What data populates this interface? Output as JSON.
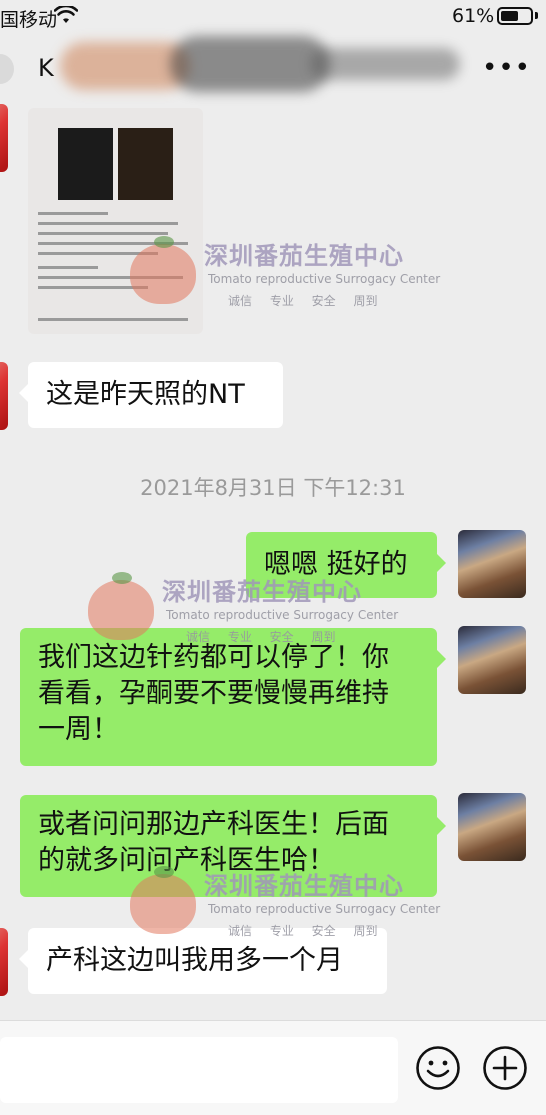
{
  "status_bar": {
    "carrier": "国移动",
    "battery_percent": "61%",
    "battery_level": 0.61
  },
  "nav": {
    "title": "K",
    "more_label": "•••"
  },
  "messages": [
    {
      "side": "in",
      "type": "text",
      "text": "这是昨天照的NT"
    },
    {
      "side": "out",
      "type": "text",
      "text": "嗯嗯 挺好的"
    },
    {
      "side": "out",
      "type": "text",
      "lines": [
        "我们这边针药都可以停了！你",
        "看看，孕酮要不要慢慢再维持",
        "一周！"
      ]
    },
    {
      "side": "out",
      "type": "text",
      "lines": [
        "或者问问那边产科医生！后面",
        "的就多问问产科医生哈！"
      ]
    },
    {
      "side": "in",
      "type": "text",
      "text": "产科这边叫我用多一个月"
    }
  ],
  "timestamp": "2021年8月31日 下午12:31",
  "watermark": {
    "title": "深圳番茄生殖中心",
    "subtitle": "Tomato reproductive Surrogacy Center",
    "tagline": "诚信 专业 安全 周到"
  },
  "icons": {
    "wifi": "wifi-icon",
    "emoji": "emoji-icon",
    "add": "plus-circle-icon",
    "more": "more-icon"
  }
}
